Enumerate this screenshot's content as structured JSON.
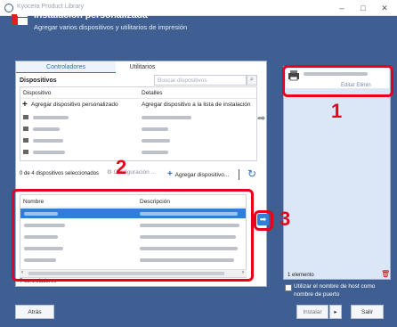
{
  "window": {
    "title": "Kyocera Product Library"
  },
  "header": {
    "title": "Instalación personalizada",
    "subtitle": "Agregar varios dispositivos y utilitarios de impresión"
  },
  "tabs": [
    {
      "label": "Controladores"
    },
    {
      "label": "Utilitarios"
    }
  ],
  "devices": {
    "title": "Dispositivos",
    "search_placeholder": "Buscar dispositivos",
    "columns": [
      "Dispositivo",
      "Detalles"
    ],
    "add_row": {
      "device": "Agregar dispositivo personalizado",
      "details": "Agregar dispositivo a la lista de instalación"
    },
    "selection_count": "0 de 4 dispositivos seleccionados",
    "configure_label": "Configuración ...",
    "add_device_label": "Agregar dispositivo..."
  },
  "drivers": {
    "columns": [
      "Nombre",
      "Descripción"
    ],
    "count_label": "7 controladores"
  },
  "right_panel": {
    "edit_label": "Editar",
    "remove_label": "Elimin",
    "element_count": "1 elemento",
    "host_option": "Utilizar el nombre de host como nombre de puerto"
  },
  "footer": {
    "back": "Atrás",
    "install": "Instalar",
    "exit": "Salir"
  },
  "annotations": {
    "one": "1",
    "two": "2",
    "three": "3"
  },
  "colors": {
    "header": "#3f5f92",
    "accent": "#2f7fd8",
    "callout": "#e8001c"
  }
}
